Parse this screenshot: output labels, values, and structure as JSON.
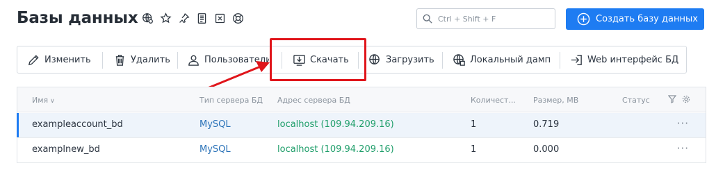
{
  "header": {
    "title": "Базы данных",
    "search_placeholder": "Ctrl + Shift + F",
    "create_label": "Создать базу данных"
  },
  "toolbar": {
    "edit": "Изменить",
    "delete": "Удалить",
    "users": "Пользователи",
    "download": "Скачать",
    "upload": "Загрузить",
    "local_dump": "Локальный дамп",
    "web_ui": "Web интерфейс БД"
  },
  "table": {
    "columns": {
      "name": "Имя",
      "server_type": "Тип сервера БД",
      "server_address": "Адрес сервера БД",
      "count": "Количест...",
      "size": "Размер, MB",
      "status": "Статус"
    },
    "rows": [
      {
        "name": "exampleaccount_bd",
        "server_type": "MySQL",
        "server_address": "localhost (109.94.209.16)",
        "count": "1",
        "size": "0.719",
        "menu": "···"
      },
      {
        "name": "examplnew_bd",
        "server_type": "MySQL",
        "server_address": "localhost (109.94.209.16)",
        "count": "1",
        "size": "0.000",
        "menu": "···"
      }
    ]
  },
  "colors": {
    "accent": "#1e7cf2",
    "highlight": "#e0151b",
    "address": "#1f9e6a",
    "link": "#2a72b8"
  }
}
